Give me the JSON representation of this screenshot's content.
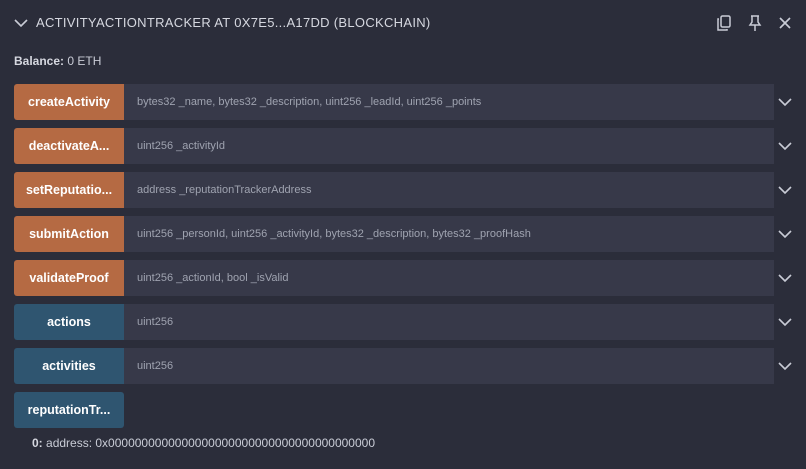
{
  "header": {
    "title": "ACTIVITYACTIONTRACKER AT 0X7E5...A17DD (BLOCKCHAIN)",
    "icons": [
      "copy-icon",
      "pin-icon",
      "close-icon"
    ]
  },
  "balance": {
    "label": "Balance:",
    "value": "0 ETH"
  },
  "functions": [
    {
      "label": "createActivity",
      "placeholder": "bytes32 _name, bytes32 _description, uint256 _leadId, uint256 _points",
      "kind": "transact"
    },
    {
      "label": "deactivateA...",
      "placeholder": "uint256 _activityId",
      "kind": "transact"
    },
    {
      "label": "setReputatio...",
      "placeholder": "address _reputationTrackerAddress",
      "kind": "transact"
    },
    {
      "label": "submitAction",
      "placeholder": "uint256 _personId, uint256 _activityId, bytes32 _description, bytes32 _proofHash",
      "kind": "transact"
    },
    {
      "label": "validateProof",
      "placeholder": "uint256 _actionId, bool _isValid",
      "kind": "transact"
    },
    {
      "label": "actions",
      "placeholder": "uint256",
      "kind": "call"
    },
    {
      "label": "activities",
      "placeholder": "uint256",
      "kind": "call"
    },
    {
      "label": "reputationTr...",
      "kind": "call"
    }
  ],
  "result": {
    "index": "0:",
    "text": "address: 0x0000000000000000000000000000000000000000"
  },
  "colors": {
    "background": "#2b2d3a",
    "transact_button": "#b56a43",
    "call_button": "#2f5570",
    "input": "#373949"
  }
}
